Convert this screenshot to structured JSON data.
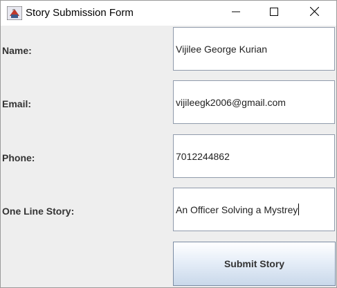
{
  "window": {
    "title": "Story Submission Form",
    "icons": {
      "app": "java-cup-icon",
      "minimize": "minimize-icon",
      "maximize": "maximize-icon",
      "close": "close-icon"
    }
  },
  "form": {
    "name_label": "Name:",
    "name_value": "Vijilee George Kurian",
    "email_label": "Email:",
    "email_value": "vijileegk2006@gmail.com",
    "phone_label": "Phone:",
    "phone_value": "7012244862",
    "story_label": "One Line Story:",
    "story_value": "An Officer Solving a Mystrey",
    "submit_label": "Submit Story"
  },
  "colors": {
    "background": "#eeeeee",
    "field_border": "#8f9aab",
    "button_gradient_top": "#ffffff",
    "button_gradient_bottom": "#c9d8ea"
  }
}
